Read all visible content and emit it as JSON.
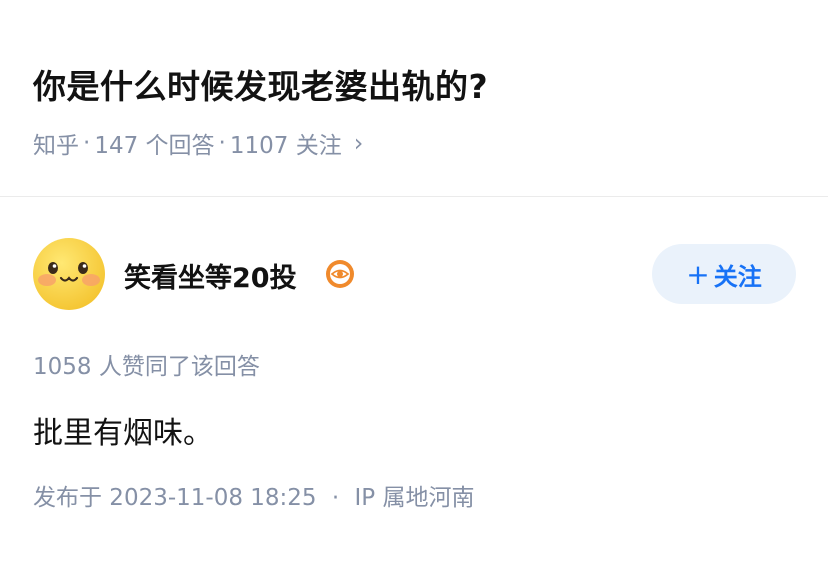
{
  "question": {
    "title": "你是什么时候发现老婆出轨的?",
    "source": "知乎",
    "answers": "147 个回答",
    "followers": "1107 关注",
    "dot": "·",
    "chevron": "›"
  },
  "author": {
    "name": "笑看坐等20投",
    "avatar_icon": "smiling-emoji-avatar",
    "badge_icon": "eye-badge-icon",
    "follow_plus": "+",
    "follow_label": "关注"
  },
  "answer": {
    "votes": "1058 人赞同了该回答",
    "content": "批里有烟味。",
    "published": "发布于 2023-11-08 18:25",
    "separator": "·",
    "ip": "IP 属地河南"
  },
  "colors": {
    "accent": "#1772f6",
    "follow_bg": "#eaf2fb",
    "meta_text": "#8590a6",
    "badge_orange": "#f08a2c"
  }
}
